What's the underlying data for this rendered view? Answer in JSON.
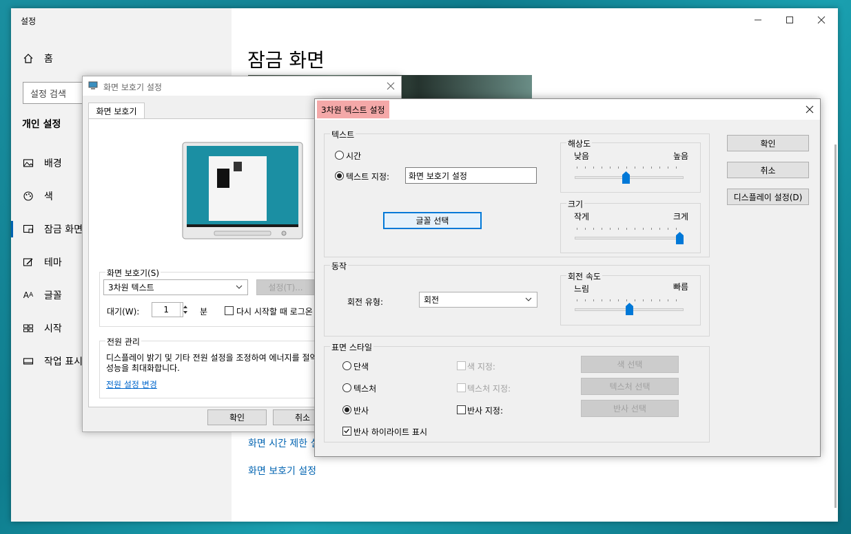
{
  "settings": {
    "title": "설정",
    "search_placeholder": "설정 검색",
    "home": "홈",
    "section": "개인 설정",
    "nav": [
      "배경",
      "색",
      "잠금 화면",
      "테마",
      "글꼴",
      "시작",
      "작업 표시줄"
    ],
    "page_title": "잠금 화면",
    "link_screen_timeout": "화면 시간 제한 설정",
    "link_screensaver": "화면 보호기 설정"
  },
  "ss_dialog": {
    "title": "화면 보호기 설정",
    "tab": "화면 보호기",
    "group_label": "화면 보호기(S)",
    "selected_saver": "3차원 텍스트",
    "settings_button": "설정(T)...",
    "wait_label": "대기(W):",
    "wait_value": "1",
    "wait_unit": "분",
    "resume_label": "다시 시작할 때 로그온 화면 표시",
    "power_group": "전원 관리",
    "power_text_1": "디스플레이 밝기 및 기타 전원 설정을 조정하여 에너지를 절약하거나",
    "power_text_2": "성능을 최대화합니다.",
    "power_link": "전원 설정 변경",
    "ok": "확인",
    "cancel": "취소"
  },
  "td_dialog": {
    "title": "3차원 텍스트 설정",
    "text_group": "텍스트",
    "radio_time": "시간",
    "radio_custom": "텍스트 지정:",
    "custom_text": "화면 보호기 설정",
    "font_button": "글꼴 선택",
    "resolution_group": "해상도",
    "res_low": "낮음",
    "res_high": "높음",
    "resolution_value": 0.47,
    "size_group": "크기",
    "size_small": "작게",
    "size_large": "크게",
    "size_value": 1.0,
    "motion_group": "동작",
    "rotation_type_label": "회전 유형:",
    "rotation_type": "회전",
    "speed_group": "회전 속도",
    "speed_slow": "느림",
    "speed_fast": "빠름",
    "speed_value": 0.5,
    "surface_group": "표면 스타일",
    "solid": "단색",
    "texture": "텍스처",
    "reflection": "반사",
    "color_pick": "색 지정:",
    "texture_pick": "텍스처 지정:",
    "reflection_pick": "반사 지정:",
    "color_btn": "색 선택",
    "texture_btn": "텍스처 선택",
    "reflection_btn": "반사 선택",
    "highlight": "반사 하이라이트 표시",
    "ok": "확인",
    "cancel": "취소",
    "display_settings": "디스플레이 설정(D)"
  }
}
